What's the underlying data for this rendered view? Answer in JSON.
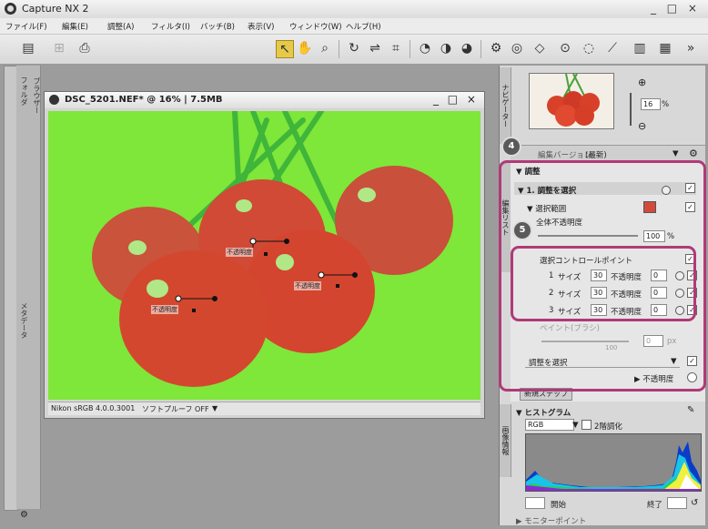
{
  "window": {
    "title": "Capture NX 2",
    "controls": "_ □ ×"
  },
  "menu": [
    "ファイル(F)",
    "編集(E)",
    "調整(A)",
    "フィルタ(I)",
    "バッチ(B)",
    "表示(V)",
    "ウィンドウ(W)",
    "ヘルプ(H)"
  ],
  "left_dock": {
    "tab_browser": "ブラウザー",
    "tab_folder": "フォルダ",
    "tab_meta": "メタデータ"
  },
  "image_window": {
    "title": "DSC_5201.NEF* @ 16% | 7.5MB",
    "controls": "_ □ ×",
    "status_profile": "Nikon sRGB 4.0.0.3001",
    "status_softproof": "ソフトプルーフ OFF"
  },
  "control_points": [
    {
      "label": "不透明度"
    },
    {
      "label": "不透明度"
    },
    {
      "label": "不透明度"
    }
  ],
  "navigator": {
    "tab": "ナビゲーター",
    "zoom_value": "16",
    "zoom_unit": "%"
  },
  "edit_list": {
    "tab": "編集リスト",
    "version_label": "編集バージョン",
    "version_value": "(最新)",
    "section_adjust": "▼ 調整",
    "step_title": "▼ 1. 調整を選択",
    "selection_range": "▼ 選択範囲",
    "overall_opacity": "全体不透明度",
    "overall_value": "100",
    "overall_unit": "%",
    "cp_header": "選択コントロールポイント",
    "cp_rows": [
      {
        "idx": "1",
        "size_label": "サイズ",
        "size": "30",
        "opacity_label": "不透明度",
        "opacity": "0"
      },
      {
        "idx": "2",
        "size_label": "サイズ",
        "size": "30",
        "opacity_label": "不透明度",
        "opacity": "0"
      },
      {
        "idx": "3",
        "size_label": "サイズ",
        "size": "30",
        "opacity_label": "不透明度",
        "opacity": "0"
      }
    ],
    "brush_label": "ペイント(ブラシ)",
    "brush_value": "0",
    "brush_unit": "px",
    "brush_max": "100",
    "adjust_select": "調整を選択",
    "opacity_label": "▶ 不透明度",
    "new_step": "新規ステップ"
  },
  "histogram": {
    "tab": "画像情報",
    "title": "▼ ヒストグラム",
    "channel": "RGB",
    "gradation_label": "2階調化",
    "start_label": "開始",
    "end_label": "終了",
    "monitor_points": "▶ モニターポイント"
  },
  "callouts": {
    "four": "4",
    "five": "5"
  },
  "accent_colors": {
    "highlight": "#b03a78",
    "photo_green": "#7fe63a",
    "toolbar_selected": "#e6c94c"
  }
}
